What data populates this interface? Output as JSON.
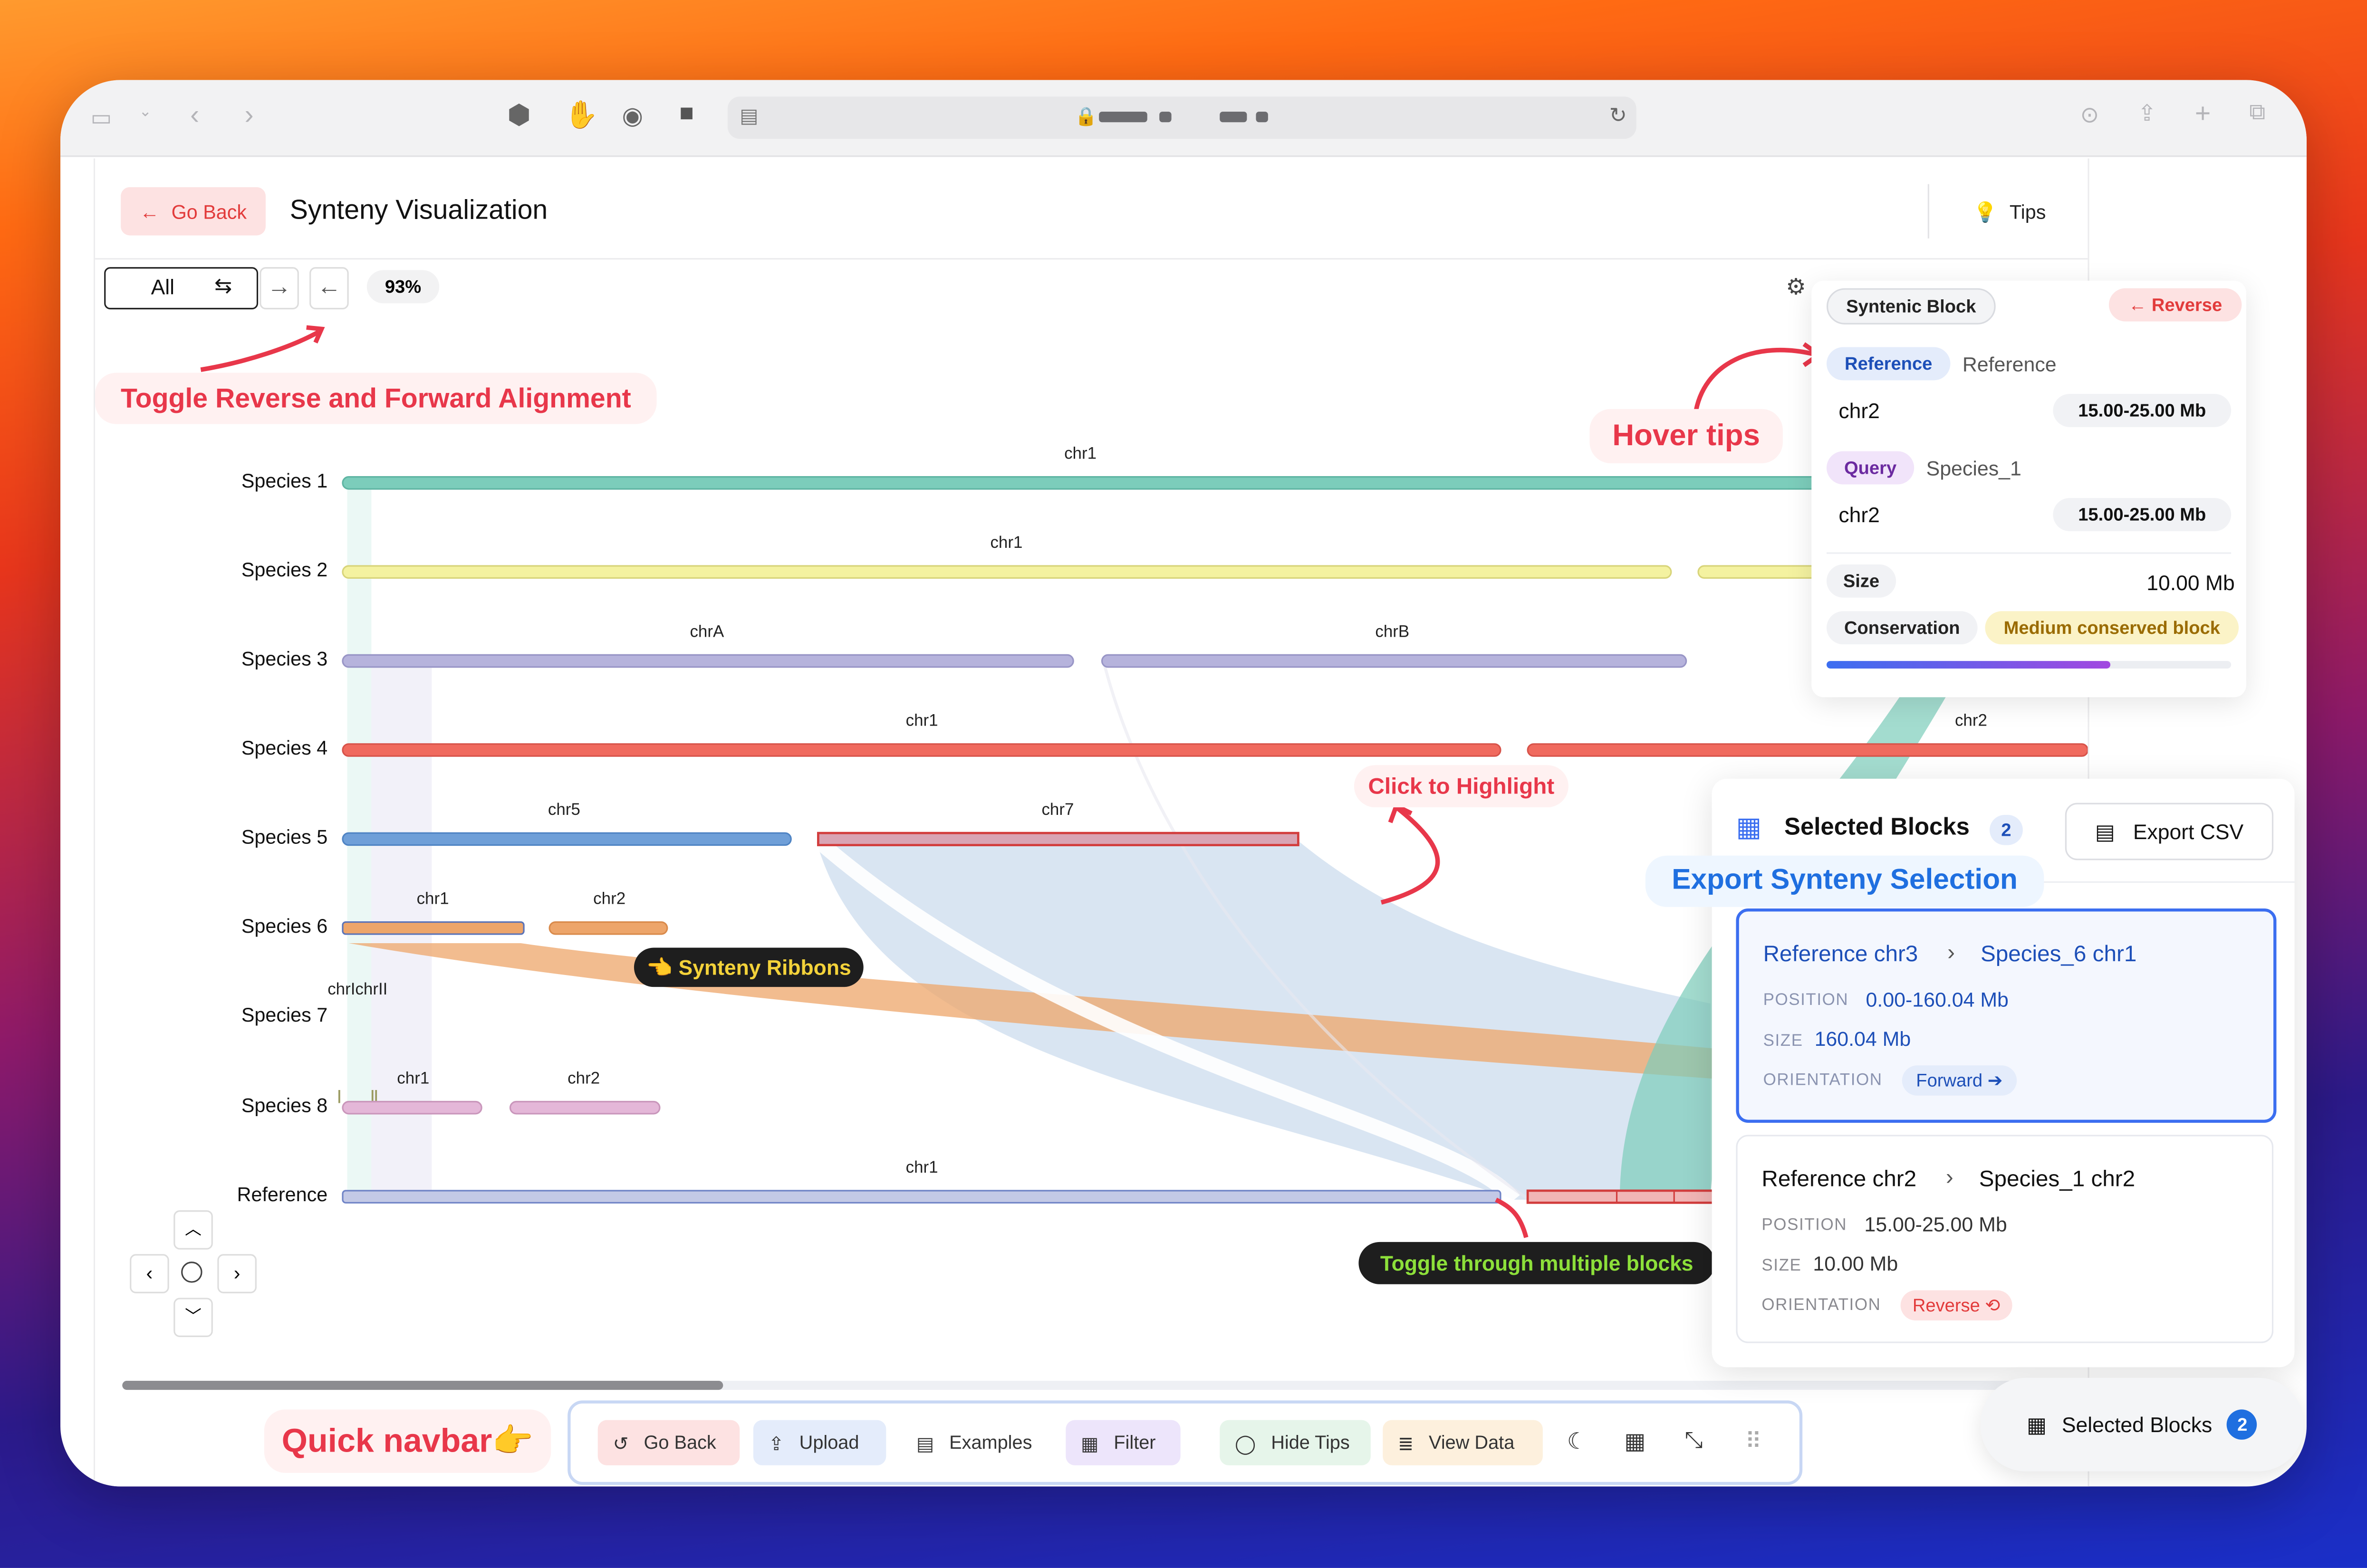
{
  "header": {
    "go_back": "Go Back",
    "title": "Synteny Visualization",
    "tips": "Tips"
  },
  "toolbar": {
    "filter_value": "All",
    "zoom": "93%"
  },
  "species": [
    {
      "label": "Species 1",
      "chromosomes": [
        "chr1"
      ]
    },
    {
      "label": "Species 2",
      "chromosomes": [
        "chr1"
      ]
    },
    {
      "label": "Species 3",
      "chromosomes": [
        "chrA",
        "chrB"
      ]
    },
    {
      "label": "Species 4",
      "chromosomes": [
        "chr1",
        "chr2"
      ]
    },
    {
      "label": "Species 5",
      "chromosomes": [
        "chr5",
        "chr7"
      ]
    },
    {
      "label": "Species 6",
      "chromosomes": [
        "chr1",
        "chr2"
      ]
    },
    {
      "label": "Species 7",
      "chromosomes": [
        "chrIchrII"
      ]
    },
    {
      "label": "Species 8",
      "chromosomes": [
        "chr1",
        "chr2"
      ]
    },
    {
      "label": "Reference",
      "chromosomes": [
        "chr1"
      ]
    }
  ],
  "annotations": {
    "toggle_alignment": "Toggle Reverse and Forward Alignment",
    "hover_tips": "Hover tips",
    "click_highlight": "Click to Highlight",
    "synteny_ribbons": "👈 Synteny Ribbons",
    "toggle_blocks": "Toggle through multiple blocks",
    "export_selection": "Export Synteny Selection",
    "quick_navbar": "Quick navbar👉"
  },
  "tooltip": {
    "title": "Syntenic Block",
    "reverse": "Reverse",
    "reference_tag": "Reference",
    "reference_name": "Reference",
    "reference_chr": "chr2",
    "reference_range": "15.00-25.00 Mb",
    "query_tag": "Query",
    "query_name": "Species_1",
    "query_chr": "chr2",
    "query_range": "15.00-25.00 Mb",
    "size_label": "Size",
    "size_value": "10.00 Mb",
    "conservation_label": "Conservation",
    "conservation_value": "Medium conserved block",
    "conservation_level": 0.7
  },
  "selected_panel": {
    "title": "Selected Blocks",
    "count": "2",
    "export": "Export CSV",
    "blocks": [
      {
        "ref": "Reference chr3",
        "query": "Species_6 chr1",
        "position_label": "POSITION",
        "position": "0.00-160.04 Mb",
        "size_label": "SIZE",
        "size": "160.04 Mb",
        "orientation_label": "ORIENTATION",
        "orientation": "Forward ➔"
      },
      {
        "ref": "Reference chr2",
        "query": "Species_1 chr2",
        "position_label": "POSITION",
        "position": "15.00-25.00 Mb",
        "size_label": "SIZE",
        "size": "10.00 Mb",
        "orientation_label": "ORIENTATION",
        "orientation": "Reverse ⟲"
      }
    ]
  },
  "navbar": {
    "go_back": "Go Back",
    "upload": "Upload",
    "examples": "Examples",
    "filter": "Filter",
    "hide_tips": "Hide Tips",
    "view_data": "View Data"
  },
  "floating": {
    "label": "Selected Blocks",
    "count": "2"
  },
  "colors": {
    "accent_red": "#e23b3b",
    "accent_blue": "#1f6fe0",
    "species1": "#7ccdbb",
    "species2": "#f4f2a0",
    "species3": "#b6b3dc",
    "species4": "#f06a5e",
    "species5": "#6f9fd8",
    "species6": "#eda56a",
    "species8": "#e4b7d8",
    "reference": "#c3c9e6"
  }
}
